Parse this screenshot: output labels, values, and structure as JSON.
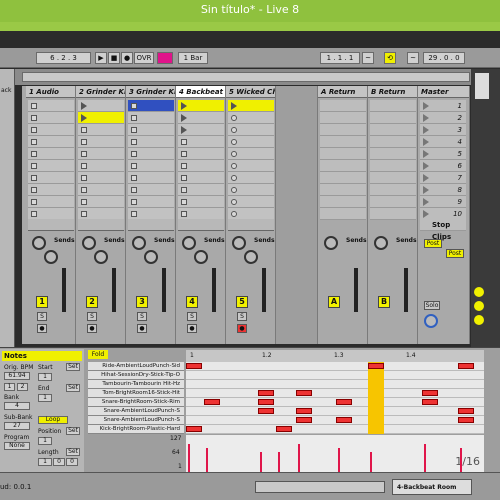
{
  "window": {
    "title": "Sin título* - Live 8"
  },
  "transport": {
    "tempo_pos": "6 . 2 . 3",
    "ovr": "OVR",
    "quant": "1 Bar",
    "loop_start": "1 . 1 . 1",
    "loop_len": "29 . 0 . 0",
    "play_label": "▶",
    "stop_label": "■",
    "rec_label": "●"
  },
  "browser": {
    "label": "ack"
  },
  "tracks": [
    {
      "name": "1 Audio",
      "num": "1"
    },
    {
      "name": "2 Grinder Kit",
      "num": "2"
    },
    {
      "name": "3 Grinder Kit",
      "num": "3"
    },
    {
      "name": "4 Backbeat",
      "num": "4"
    },
    {
      "name": "5 Wicked Ch",
      "num": "5"
    }
  ],
  "returns": [
    {
      "name": "A Return",
      "num": "A"
    },
    {
      "name": "B Return",
      "num": "B"
    }
  ],
  "master": {
    "name": "Master",
    "scenes": [
      "1",
      "2",
      "3",
      "4",
      "5",
      "6",
      "7",
      "8",
      "9",
      "10"
    ],
    "stop_clips": "Stop Clips",
    "post": "Post",
    "solo": "Solo"
  },
  "sends_label": "Sends",
  "io_values": {
    "t2": "0",
    "t2b": "4",
    "t3": "0",
    "t3b": "4",
    "t4": "0",
    "t4b": "4",
    "t5": "0",
    "t5b": "4"
  },
  "clip": {
    "header": "Notes",
    "fold": "Fold",
    "orig_bpm_label": "Orig. BPM",
    "orig_bpm": "61.94",
    "start_label": "Start",
    "end_label": "End",
    "bank_label": "Bank",
    "bank_value": "4",
    "subbank_label": "Sub-Bank",
    "subbank_value": "27",
    "program_label": "Program",
    "program_value": "None",
    "loop_label": "Loop",
    "position_label": "Position",
    "length_label": "Length",
    "set_label": "Set",
    "start_value": "1",
    "end_value": "1",
    "pos_value": "1",
    "len_value": "1",
    "len_b": "0",
    "len_c": "0",
    "x2a": "1",
    "x2b": "2"
  },
  "ruler": {
    "marks": [
      "1",
      "1.2",
      "1.3",
      "1.4"
    ]
  },
  "keys": [
    "Ride-AmbientLoudPunch-Sid",
    "Hihat-SessionDry-Stick-Tip-O",
    "Tambourin-Tambourin Hit-Hz",
    "Tom-BrightRoom16-Stick-Hit",
    "Snare-BrightRoom-Stick-Rim",
    "Snare-AmbientLoudPunch-S",
    "Snare-AmbientLoudPunch-S",
    "Kick-BrightRoom-Plastic-Hard"
  ],
  "velocity": {
    "max": "127",
    "mid": "64",
    "min": "1"
  },
  "page_indicator": "1/16",
  "status": {
    "left": "ud: 0.0.1",
    "track": "4-Backbeat Room"
  },
  "colors": {
    "accent": "#8fc13e",
    "clip": "#f0f000",
    "note": "#e33333",
    "playhead": "#f7c500"
  }
}
